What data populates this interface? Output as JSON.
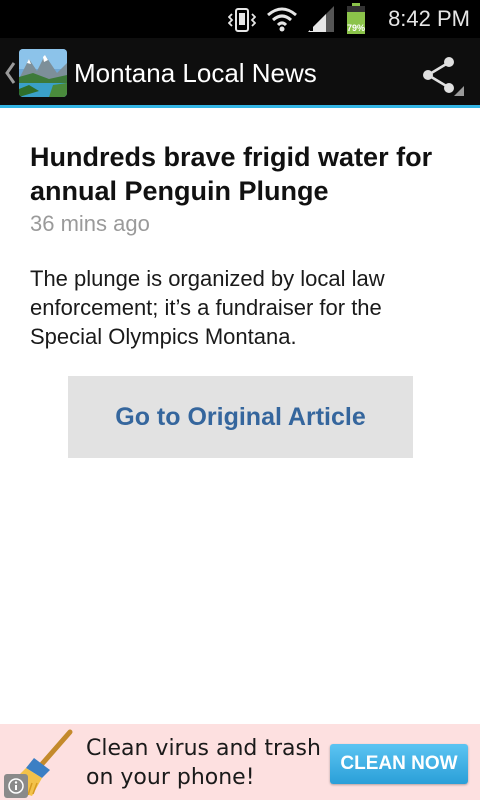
{
  "status_bar": {
    "time": "8:42 PM",
    "battery_percent": "79%",
    "battery_level": 0.79,
    "icons": [
      "vibrate-icon",
      "wifi-icon",
      "signal-icon",
      "battery-icon"
    ]
  },
  "action_bar": {
    "title": "Montana Local News",
    "up_icon": "chevron-left-icon",
    "app_icon": "mountain-lake-icon",
    "share_icon": "share-icon",
    "accent_color": "#33b5e5"
  },
  "article": {
    "headline": "Hundreds brave frigid water for annual Penguin Plunge",
    "timestamp": "36 mins ago",
    "summary": "The plunge is organized by local law enforcement; it’s a fundraiser for the Special Olympics Montana.",
    "original_button_label": "Go to Original Article"
  },
  "ad": {
    "text": "Clean virus and trash on your phone!",
    "text_line1": "Clean virus and trash",
    "text_line2": "on your phone!",
    "cta_label": "CLEAN NOW",
    "info_icon": "info-icon",
    "broom_icon": "broom-icon"
  }
}
